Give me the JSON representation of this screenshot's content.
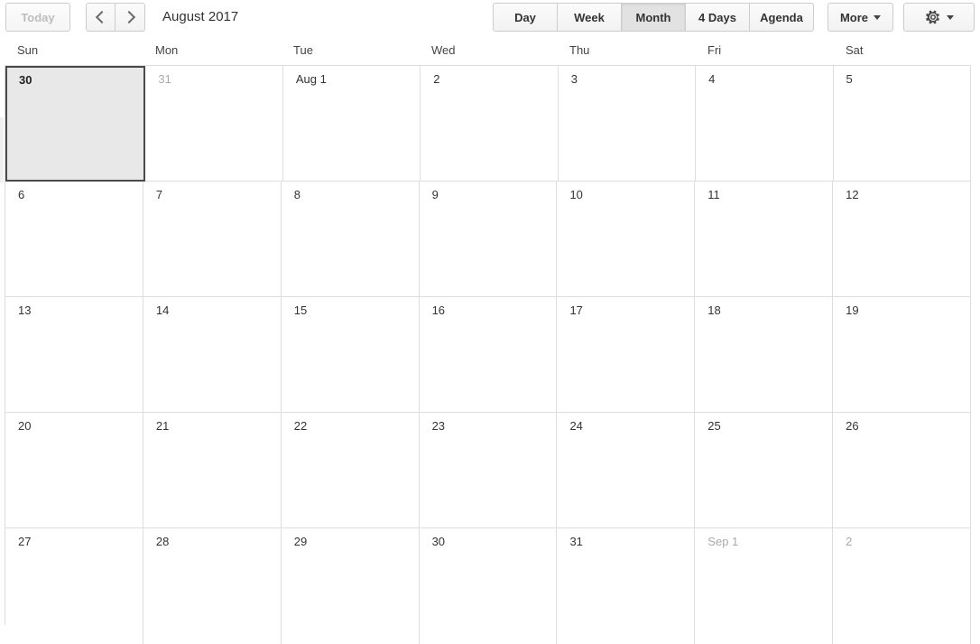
{
  "toolbar": {
    "today_label": "Today",
    "today_disabled": true,
    "prev_label": "Previous period",
    "next_label": "Next period",
    "title": "August 2017",
    "views": [
      {
        "label": "Day",
        "active": false
      },
      {
        "label": "Week",
        "active": false
      },
      {
        "label": "Month",
        "active": true
      },
      {
        "label": "4 Days",
        "active": false
      },
      {
        "label": "Agenda",
        "active": false
      }
    ],
    "more_label": "More",
    "settings_label": "Settings"
  },
  "calendar": {
    "day_names": [
      "Sun",
      "Mon",
      "Tue",
      "Wed",
      "Thu",
      "Fri",
      "Sat"
    ],
    "weeks": [
      [
        {
          "label": "30",
          "other_month": false,
          "selected": true
        },
        {
          "label": "31",
          "other_month": true,
          "selected": false
        },
        {
          "label": "Aug 1",
          "other_month": false,
          "selected": false
        },
        {
          "label": "2",
          "other_month": false,
          "selected": false
        },
        {
          "label": "3",
          "other_month": false,
          "selected": false
        },
        {
          "label": "4",
          "other_month": false,
          "selected": false
        },
        {
          "label": "5",
          "other_month": false,
          "selected": false
        }
      ],
      [
        {
          "label": "6",
          "other_month": false,
          "selected": false
        },
        {
          "label": "7",
          "other_month": false,
          "selected": false
        },
        {
          "label": "8",
          "other_month": false,
          "selected": false
        },
        {
          "label": "9",
          "other_month": false,
          "selected": false
        },
        {
          "label": "10",
          "other_month": false,
          "selected": false
        },
        {
          "label": "11",
          "other_month": false,
          "selected": false
        },
        {
          "label": "12",
          "other_month": false,
          "selected": false
        }
      ],
      [
        {
          "label": "13",
          "other_month": false,
          "selected": false
        },
        {
          "label": "14",
          "other_month": false,
          "selected": false
        },
        {
          "label": "15",
          "other_month": false,
          "selected": false
        },
        {
          "label": "16",
          "other_month": false,
          "selected": false
        },
        {
          "label": "17",
          "other_month": false,
          "selected": false
        },
        {
          "label": "18",
          "other_month": false,
          "selected": false
        },
        {
          "label": "19",
          "other_month": false,
          "selected": false
        }
      ],
      [
        {
          "label": "20",
          "other_month": false,
          "selected": false
        },
        {
          "label": "21",
          "other_month": false,
          "selected": false
        },
        {
          "label": "22",
          "other_month": false,
          "selected": false
        },
        {
          "label": "23",
          "other_month": false,
          "selected": false
        },
        {
          "label": "24",
          "other_month": false,
          "selected": false
        },
        {
          "label": "25",
          "other_month": false,
          "selected": false
        },
        {
          "label": "26",
          "other_month": false,
          "selected": false
        }
      ],
      [
        {
          "label": "27",
          "other_month": false,
          "selected": false
        },
        {
          "label": "28",
          "other_month": false,
          "selected": false
        },
        {
          "label": "29",
          "other_month": false,
          "selected": false
        },
        {
          "label": "30",
          "other_month": false,
          "selected": false
        },
        {
          "label": "31",
          "other_month": false,
          "selected": false
        },
        {
          "label": "Sep 1",
          "other_month": true,
          "selected": false
        },
        {
          "label": "2",
          "other_month": true,
          "selected": false
        }
      ]
    ]
  },
  "colors": {
    "grid_line": "#dddddd",
    "selected_bg": "#e8e8e8",
    "selected_border": "#4a4a4a",
    "other_month_text": "#aaaaaa",
    "text": "#333333",
    "button_face": "#f7f7f7",
    "button_active": "#e2e2e2",
    "disabled_text": "#bdbdbd"
  }
}
